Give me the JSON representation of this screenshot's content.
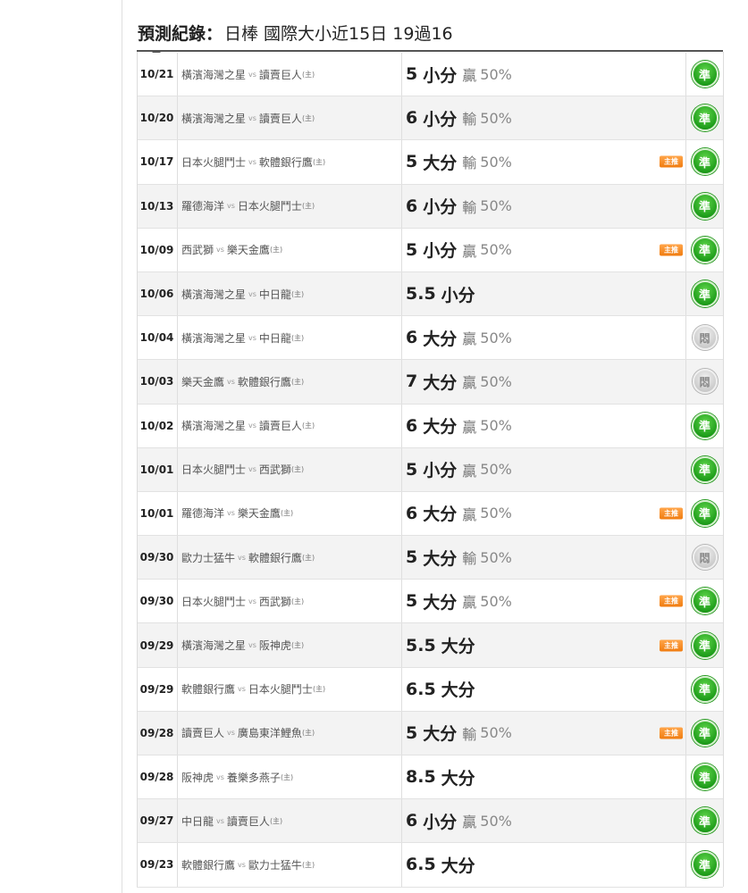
{
  "header": {
    "label": "預測紀錄：",
    "text": "日棒 國際大小近15日 19過16"
  },
  "vs_text": "vs",
  "home_marker": "(主)",
  "tag_text": "主推",
  "colors": {
    "hit": "#1f9e1b",
    "push": "#c9c9c9",
    "tag": "#f07c10"
  },
  "records": [
    {
      "date": "10/21",
      "away": "橫濱海灣之星",
      "home": "讀賣巨人",
      "line": "5",
      "side": "小分",
      "result": "贏",
      "pct": "50%",
      "tag": false,
      "status": "hit",
      "status_text": "準",
      "status_icon": "check-hit-icon"
    },
    {
      "date": "10/20",
      "away": "橫濱海灣之星",
      "home": "讀賣巨人",
      "line": "6",
      "side": "小分",
      "result": "輸",
      "pct": "50%",
      "tag": false,
      "status": "hit",
      "status_text": "準",
      "status_icon": "check-hit-icon"
    },
    {
      "date": "10/17",
      "away": "日本火腿鬥士",
      "home": "軟體銀行鷹",
      "line": "5",
      "side": "大分",
      "result": "輸",
      "pct": "50%",
      "tag": true,
      "status": "hit",
      "status_text": "準",
      "status_icon": "check-hit-icon"
    },
    {
      "date": "10/13",
      "away": "羅德海洋",
      "home": "日本火腿鬥士",
      "line": "6",
      "side": "小分",
      "result": "輸",
      "pct": "50%",
      "tag": false,
      "status": "hit",
      "status_text": "準",
      "status_icon": "check-hit-icon"
    },
    {
      "date": "10/09",
      "away": "西武獅",
      "home": "樂天金鷹",
      "line": "5",
      "side": "小分",
      "result": "贏",
      "pct": "50%",
      "tag": true,
      "status": "hit",
      "status_text": "準",
      "status_icon": "check-hit-icon"
    },
    {
      "date": "10/06",
      "away": "橫濱海灣之星",
      "home": "中日龍",
      "line": "5.5",
      "side": "小分",
      "result": "",
      "pct": "",
      "tag": false,
      "status": "hit",
      "status_text": "準",
      "status_icon": "check-hit-icon"
    },
    {
      "date": "10/04",
      "away": "橫濱海灣之星",
      "home": "中日龍",
      "line": "6",
      "side": "大分",
      "result": "贏",
      "pct": "50%",
      "tag": false,
      "status": "push",
      "status_text": "悶",
      "status_icon": "push-icon"
    },
    {
      "date": "10/03",
      "away": "樂天金鷹",
      "home": "軟體銀行鷹",
      "line": "7",
      "side": "大分",
      "result": "贏",
      "pct": "50%",
      "tag": false,
      "status": "push",
      "status_text": "悶",
      "status_icon": "push-icon"
    },
    {
      "date": "10/02",
      "away": "橫濱海灣之星",
      "home": "讀賣巨人",
      "line": "6",
      "side": "大分",
      "result": "贏",
      "pct": "50%",
      "tag": false,
      "status": "hit",
      "status_text": "準",
      "status_icon": "check-hit-icon"
    },
    {
      "date": "10/01",
      "away": "日本火腿鬥士",
      "home": "西武獅",
      "line": "5",
      "side": "小分",
      "result": "贏",
      "pct": "50%",
      "tag": false,
      "status": "hit",
      "status_text": "準",
      "status_icon": "check-hit-icon"
    },
    {
      "date": "10/01",
      "away": "羅德海洋",
      "home": "樂天金鷹",
      "line": "6",
      "side": "大分",
      "result": "贏",
      "pct": "50%",
      "tag": true,
      "status": "hit",
      "status_text": "準",
      "status_icon": "check-hit-icon"
    },
    {
      "date": "09/30",
      "away": "歐力士猛牛",
      "home": "軟體銀行鷹",
      "line": "5",
      "side": "大分",
      "result": "輸",
      "pct": "50%",
      "tag": false,
      "status": "push",
      "status_text": "悶",
      "status_icon": "push-icon"
    },
    {
      "date": "09/30",
      "away": "日本火腿鬥士",
      "home": "西武獅",
      "line": "5",
      "side": "大分",
      "result": "贏",
      "pct": "50%",
      "tag": true,
      "status": "hit",
      "status_text": "準",
      "status_icon": "check-hit-icon"
    },
    {
      "date": "09/29",
      "away": "橫濱海灣之星",
      "home": "阪神虎",
      "line": "5.5",
      "side": "大分",
      "result": "",
      "pct": "",
      "tag": true,
      "status": "hit",
      "status_text": "準",
      "status_icon": "check-hit-icon"
    },
    {
      "date": "09/29",
      "away": "軟體銀行鷹",
      "home": "日本火腿鬥士",
      "line": "6.5",
      "side": "大分",
      "result": "",
      "pct": "",
      "tag": false,
      "status": "hit",
      "status_text": "準",
      "status_icon": "check-hit-icon"
    },
    {
      "date": "09/28",
      "away": "讀賣巨人",
      "home": "廣島東洋鯉魚",
      "line": "5",
      "side": "大分",
      "result": "輸",
      "pct": "50%",
      "tag": true,
      "status": "hit",
      "status_text": "準",
      "status_icon": "check-hit-icon"
    },
    {
      "date": "09/28",
      "away": "阪神虎",
      "home": "養樂多燕子",
      "line": "8.5",
      "side": "大分",
      "result": "",
      "pct": "",
      "tag": false,
      "status": "hit",
      "status_text": "準",
      "status_icon": "check-hit-icon"
    },
    {
      "date": "09/27",
      "away": "中日龍",
      "home": "讀賣巨人",
      "line": "6",
      "side": "小分",
      "result": "贏",
      "pct": "50%",
      "tag": false,
      "status": "hit",
      "status_text": "準",
      "status_icon": "check-hit-icon"
    },
    {
      "date": "09/23",
      "away": "軟體銀行鷹",
      "home": "歐力士猛牛",
      "line": "6.5",
      "side": "大分",
      "result": "",
      "pct": "",
      "tag": false,
      "status": "hit",
      "status_text": "準",
      "status_icon": "check-hit-icon"
    }
  ]
}
